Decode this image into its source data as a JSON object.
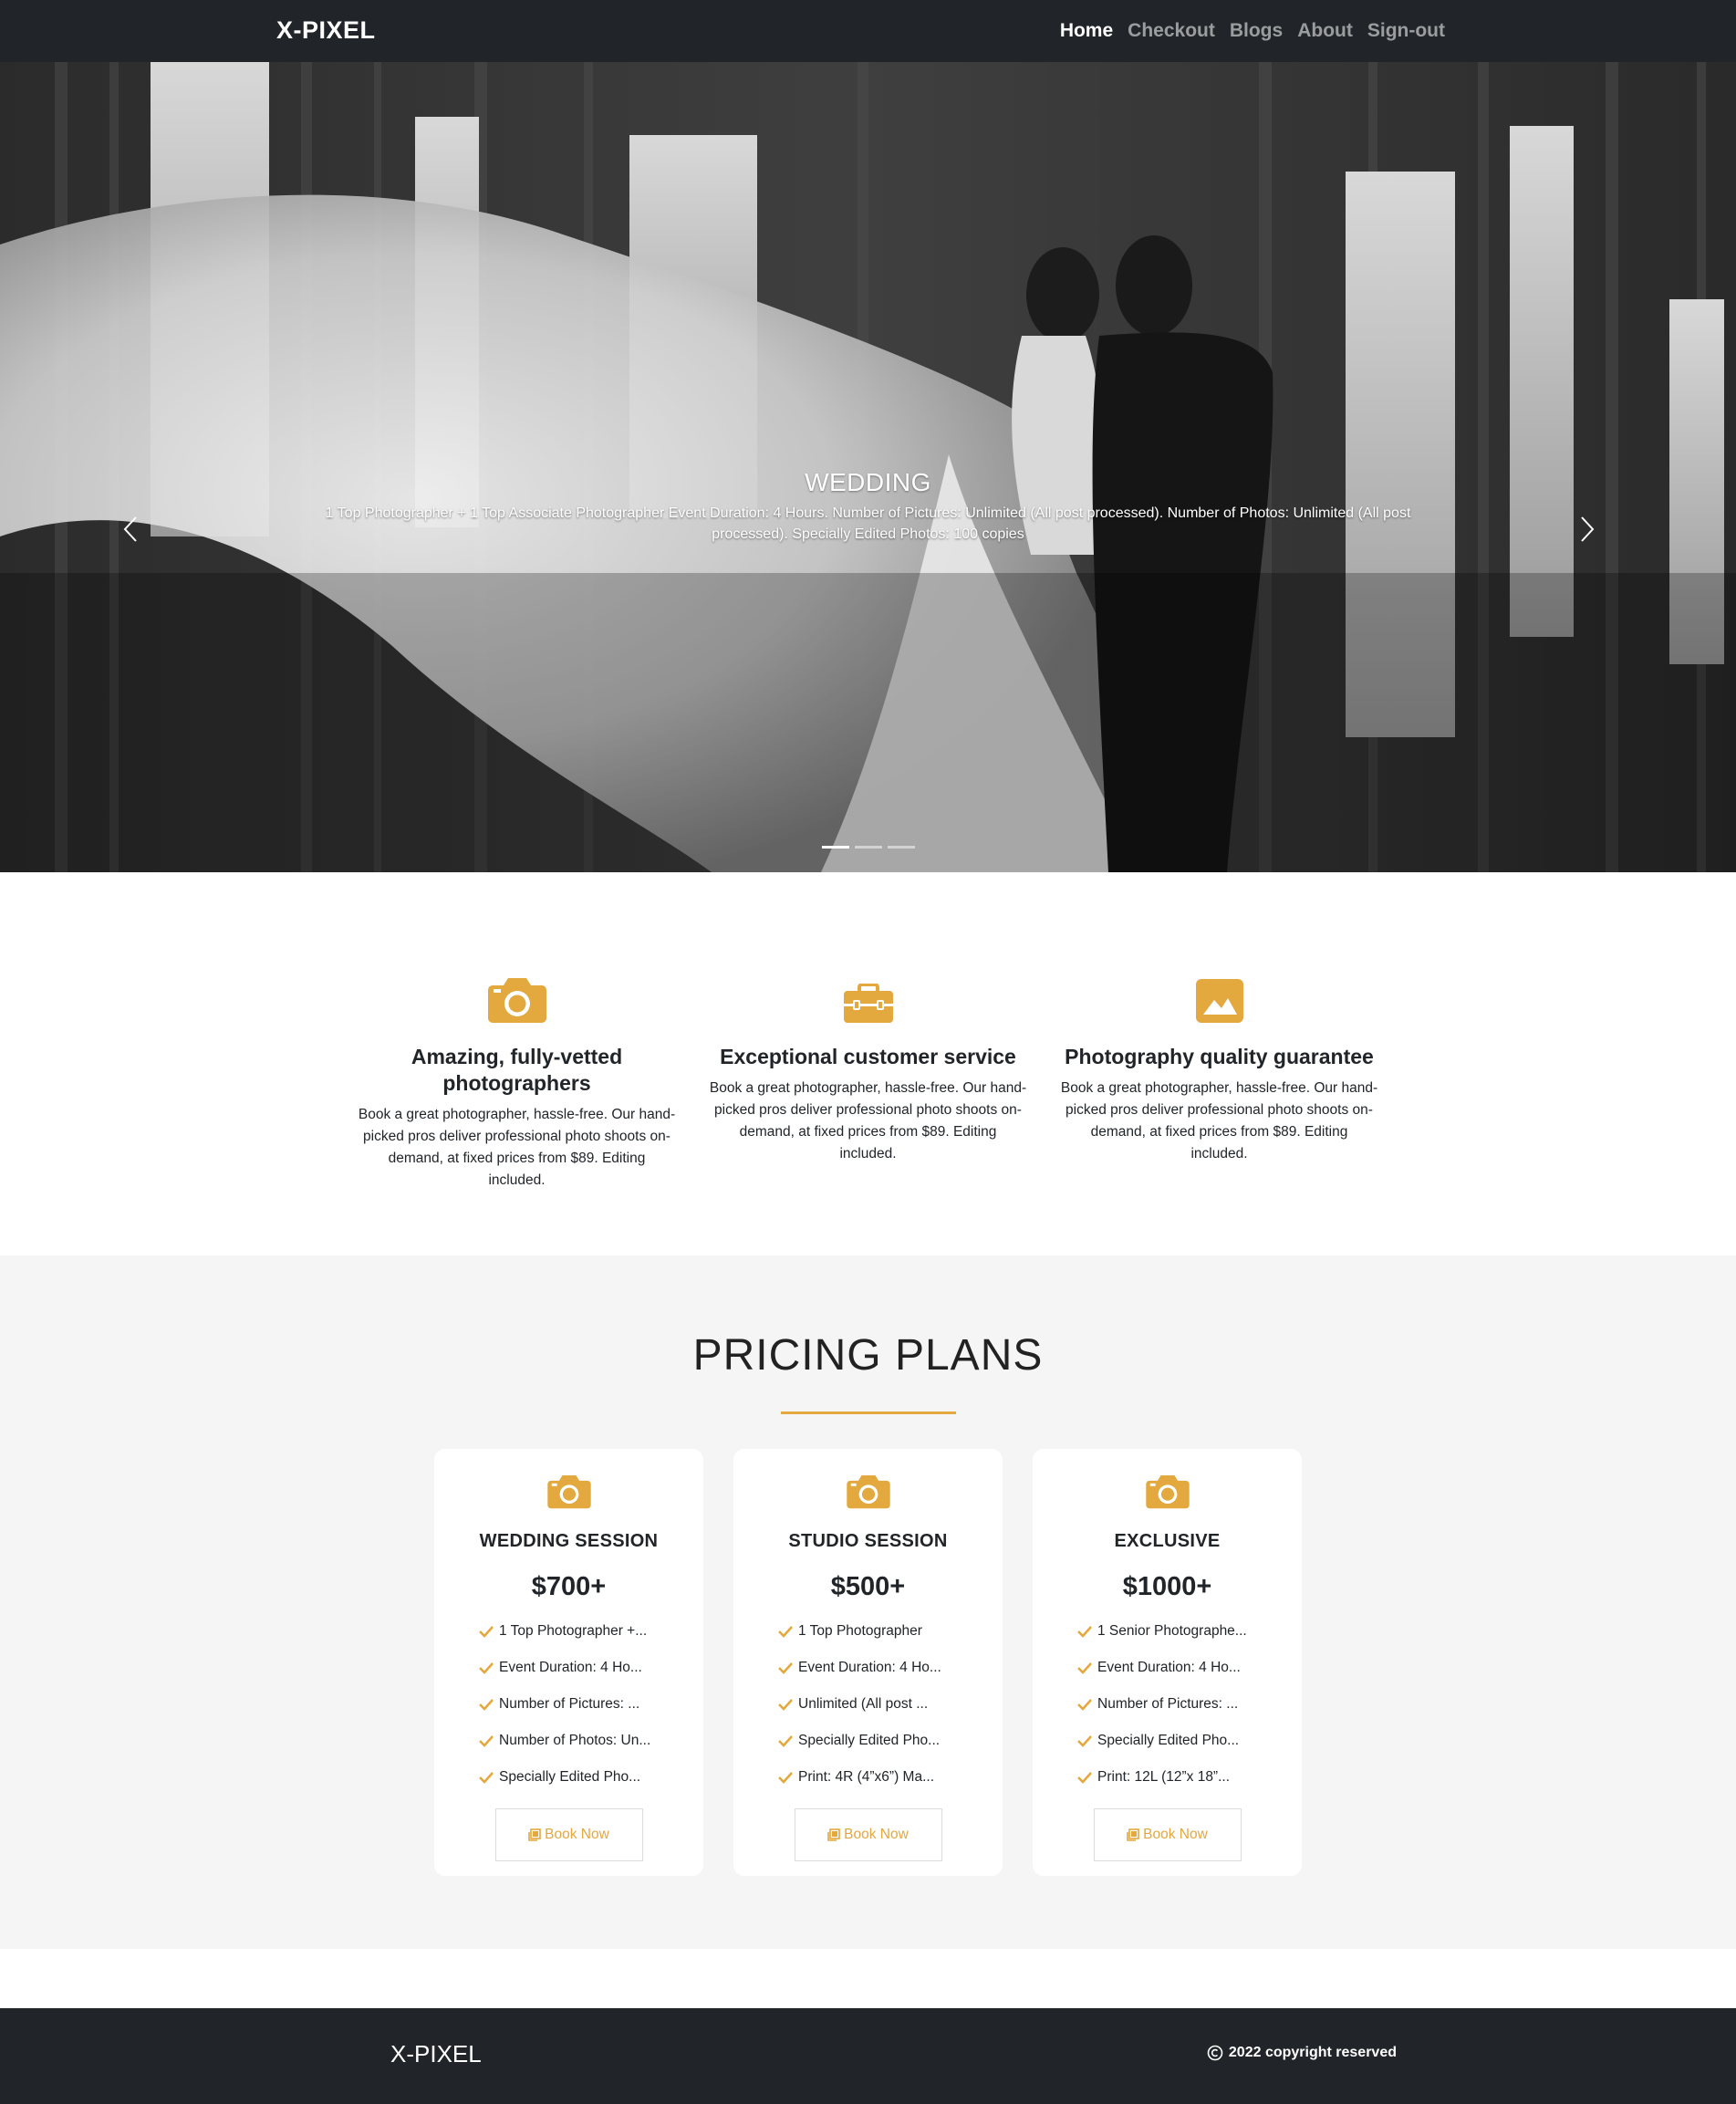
{
  "colors": {
    "accent": "#e3a83e",
    "navbar": "#212529",
    "pricing_bg": "#f5f5f5"
  },
  "navbar": {
    "brand": "X-PIXEL",
    "links": [
      {
        "label": "Home",
        "active": true
      },
      {
        "label": "Checkout"
      },
      {
        "label": "Blogs"
      },
      {
        "label": "About"
      },
      {
        "label": "Sign-out"
      }
    ]
  },
  "hero": {
    "title": "WEDDING",
    "text": "1 Top Photographer + 1 Top Associate Photographer Event Duration: 4 Hours. Number of Pictures: Unlimited (All post processed). Number of Photos: Unlimited (All post processed). Specially Edited Photos: 100 copies",
    "prev_icon": "chevron-left-icon",
    "next_icon": "chevron-right-icon",
    "slides": 3,
    "active_slide": 1
  },
  "features": [
    {
      "icon": "camera-icon",
      "title": "Amazing, fully-vetted photographers",
      "text": "Book a great photographer, hassle-free. Our hand-picked pros deliver professional photo shoots on-demand, at fixed prices from $89. Editing included."
    },
    {
      "icon": "briefcase-icon",
      "title": "Exceptional customer service",
      "text": "Book a great photographer, hassle-free. Our hand-picked pros deliver professional photo shoots on-demand, at fixed prices from $89. Editing included."
    },
    {
      "icon": "image-icon",
      "title": "Photography quality guarantee",
      "text": "Book a great photographer, hassle-free. Our hand-picked pros deliver professional photo shoots on-demand, at fixed prices from $89. Editing included."
    }
  ],
  "pricing": {
    "title": "PRICING PLANS",
    "plans": [
      {
        "name": "WEDDING SESSION",
        "price": "$700+",
        "features": [
          "1 Top Photographer +...",
          "Event Duration: 4 Ho...",
          "Number of Pictures: ...",
          "Number of Photos: Un...",
          "Specially Edited Pho..."
        ],
        "button": "Book Now"
      },
      {
        "name": "STUDIO SESSION",
        "price": "$500+",
        "features": [
          "1 Top Photographer",
          "Event Duration: 4 Ho...",
          "Unlimited (All post ...",
          "Specially Edited Pho...",
          "Print: 4R (4”x6”) Ma..."
        ],
        "button": "Book Now"
      },
      {
        "name": "EXCLUSIVE",
        "price": "$1000+",
        "features": [
          "1 Senior Photographe...",
          "Event Duration: 4 Ho...",
          "Number of Pictures: ...",
          "Specially Edited Pho...",
          "Print: 12L (12”x 18”..."
        ],
        "button": "Book Now"
      }
    ]
  },
  "footer": {
    "brand": "X-PIXEL",
    "copyright": "2022 copyright reserved",
    "copyright_icon": "copyright-icon"
  }
}
